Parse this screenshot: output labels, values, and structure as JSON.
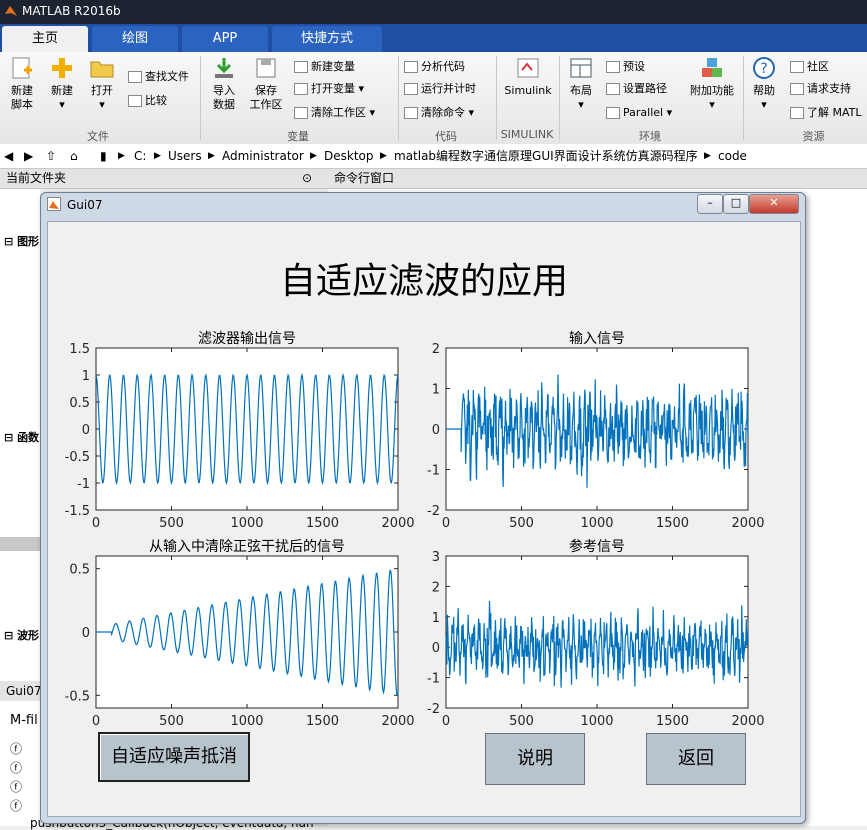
{
  "app": {
    "title": "MATLAB R2016b"
  },
  "tabs": [
    {
      "label": "主页",
      "active": true
    },
    {
      "label": "绘图",
      "active": false
    },
    {
      "label": "APP",
      "active": false
    },
    {
      "label": "快捷方式",
      "active": false
    }
  ],
  "ribbon": {
    "file": {
      "new_script": "新建\n脚本",
      "new": "新建",
      "open": "打开",
      "find_files": "查找文件",
      "compare": "比较",
      "section": "文件"
    },
    "variable": {
      "import": "导入\n数据",
      "save_ws": "保存\n工作区",
      "new_var": "新建变量",
      "open_var": "打开变量",
      "clear_ws": "清除工作区",
      "section": "变量"
    },
    "code": {
      "analyze": "分析代码",
      "run_time": "运行并计时",
      "clear_cmd": "清除命令",
      "section": "代码"
    },
    "simulink": {
      "label": "Simulink",
      "section": "SIMULINK"
    },
    "env": {
      "layout": "布局",
      "prefs": "预设",
      "set_path": "设置路径",
      "parallel": "Parallel",
      "addons": "附加功能",
      "section": "环境"
    },
    "resources": {
      "help": "帮助",
      "community": "社区",
      "support": "请求支持",
      "learn": "了解 MATL",
      "section": "资源"
    }
  },
  "address": {
    "crumbs": [
      "C:",
      "Users",
      "Administrator",
      "Desktop",
      "matlab编程数字通信原理GUI界面设计系统仿真源码程序",
      "code"
    ]
  },
  "panels": {
    "current_folder": "当前文件夹",
    "command_window": "命令行窗口"
  },
  "left_panel": {
    "groups": [
      "图形",
      "函数",
      "波形"
    ],
    "bottom_tab": "Gui07",
    "mfile": "M-fil",
    "bottom_line": "pushbutton3_Callback(hObject, eventdata, han"
  },
  "gui": {
    "title": "Gui07",
    "heading": "自适应滤波的应用",
    "buttons": {
      "adaptive": "自适应噪声抵消",
      "explain": "说明",
      "back": "返回"
    }
  },
  "chart_data": [
    {
      "type": "line",
      "title": "滤波器输出信号",
      "xlim": [
        0,
        2000
      ],
      "ylim": [
        -1.5,
        1.5
      ],
      "xticks": [
        "0",
        "500",
        "1000",
        "1500",
        "2000"
      ],
      "yticks": [
        "1.5",
        "1",
        "0.5",
        "0",
        "-0.5",
        "-1",
        "-1.5"
      ],
      "signal": {
        "kind": "sine",
        "amplitude": 1,
        "cycles": 22
      },
      "color": "#0072bd"
    },
    {
      "type": "line",
      "title": "输入信号",
      "xlim": [
        0,
        2000
      ],
      "ylim": [
        -2,
        2
      ],
      "xticks": [
        "0",
        "500",
        "1000",
        "1500",
        "2000"
      ],
      "yticks": [
        "2",
        "1",
        "0",
        "-1",
        "-2"
      ],
      "signal": {
        "kind": "noise",
        "start": 100,
        "amplitude": 1.8
      },
      "color": "#0072bd"
    },
    {
      "type": "line",
      "title": "从输入中清除正弦干扰后的信号",
      "xlim": [
        0,
        2000
      ],
      "ylim": [
        -0.6,
        0.6
      ],
      "xticks": [
        "0",
        "500",
        "1000",
        "1500",
        "2000"
      ],
      "yticks": [
        "0.5",
        "0",
        "-0.5"
      ],
      "signal": {
        "kind": "growing-sine",
        "start": 100,
        "amplitude": 0.5,
        "cycles": 22
      },
      "color": "#0072bd"
    },
    {
      "type": "line",
      "title": "参考信号",
      "xlim": [
        0,
        2000
      ],
      "ylim": [
        -2,
        3
      ],
      "xticks": [
        "0",
        "500",
        "1000",
        "1500",
        "2000"
      ],
      "yticks": [
        "3",
        "2",
        "1",
        "0",
        "-1",
        "-2"
      ],
      "signal": {
        "kind": "noise",
        "start": 0,
        "amplitude": 1.8
      },
      "color": "#0072bd"
    }
  ],
  "colors": {
    "title_bar": "#1b2430",
    "tab_bar": "#1f4fa3",
    "line": "#0072bd",
    "button": "#b7c4cc"
  }
}
